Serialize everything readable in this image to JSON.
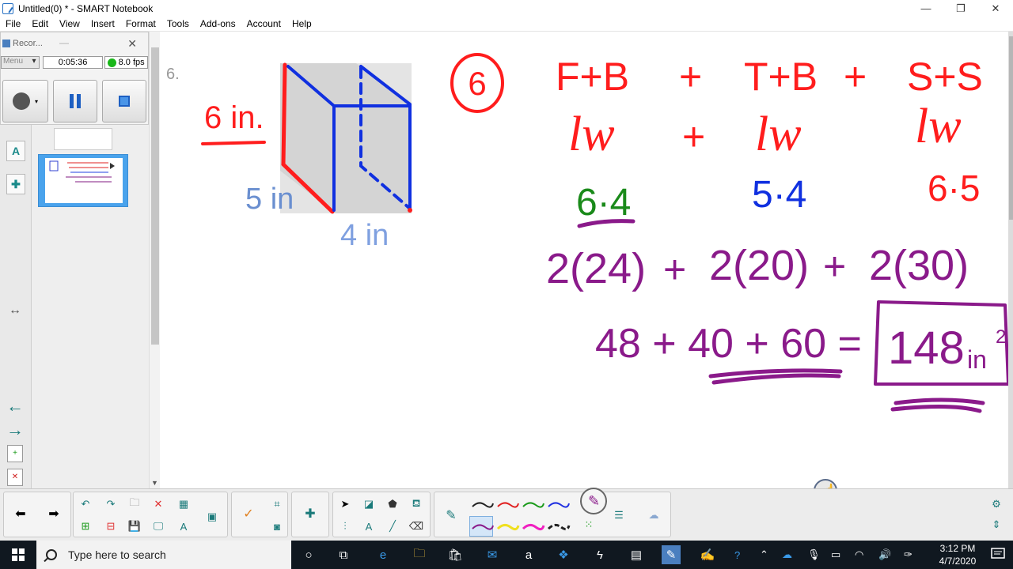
{
  "window": {
    "title": "Untitled(0) * - SMART Notebook",
    "minimize": "—",
    "restore": "❐",
    "close": "✕"
  },
  "menu": [
    "File",
    "Edit",
    "View",
    "Insert",
    "Format",
    "Tools",
    "Add-ons",
    "Account",
    "Help"
  ],
  "recorder": {
    "title": "Recor...",
    "menu_label": "Menu",
    "elapsed": "0:05:36",
    "fps": "8.0 fps"
  },
  "canvas": {
    "problem_number_small": "6.",
    "prism_labels": {
      "height": "6 in.",
      "depth": "5 in",
      "width": "4 in"
    },
    "problem_circle": "6",
    "row1": [
      "F+B",
      "+",
      "T+B",
      "+",
      "S+S"
    ],
    "row2": [
      "lw",
      "+",
      "lw",
      "lw"
    ],
    "row3": [
      "6·4",
      "5·4",
      "6·5"
    ],
    "row4": {
      "left": "2(24)",
      "plus1": "+",
      "mid": "2(20)",
      "plus2": "+",
      "right": "2(30)"
    },
    "row5": {
      "expr": "48 + 40 + 60 =",
      "answer": "148",
      "unit": "in",
      "exp": "2"
    },
    "colors": {
      "red": "#ff1d1d",
      "green": "#1a8a1a",
      "blue": "#1030e0",
      "purple": "#8a1a8a"
    }
  },
  "taskbar": {
    "search_placeholder": "Type here to search",
    "time": "3:12 PM",
    "date": "4/7/2020"
  }
}
